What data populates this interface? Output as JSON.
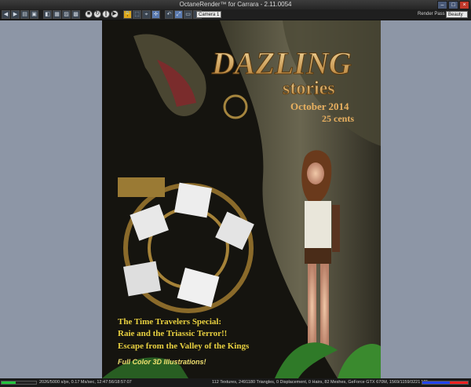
{
  "window": {
    "title": "OctaneRender™ for Carrara - 2.11.0054"
  },
  "toolbar": {
    "icons": [
      "back-icon",
      "forward-icon",
      "open-icon",
      "save-icon",
      "render-icon",
      "scene-icon",
      "image-icon",
      "settings-icon",
      "stop-icon",
      "restart-icon",
      "pause-icon",
      "start-icon",
      "lock-icon",
      "region-icon",
      "focus-icon",
      "pick-icon",
      "undo-icon",
      "fit-icon",
      "display-icon",
      "info-icon"
    ],
    "camera_value": "Camera 1",
    "render_pass_label": "Render Pass",
    "render_pass_value": "Beauty"
  },
  "cover": {
    "title_line1": "DAZLING",
    "title_line2": "stories",
    "date": "October 2014",
    "price": "25 cents",
    "headline1": "The Time Travelers Special:",
    "headline2": "Raie and the Triassic Terror!!",
    "headline3": "Escape from the Valley of the Kings",
    "tagline": "Full Color 3D Illustrations!"
  },
  "status": {
    "progress": 0.4,
    "left_text": "2026/5000 s/px, 0.17 Ms/sec, 12:47:56/18:57:07",
    "right_text": "112 Textures, 2491180 Triangles, 0 Displacement, 0 Hairs, 82 Meshes, GeForce GTX 670M, 1569/1159/3221 MB",
    "memory_colors": [
      "#2244ee",
      "#2244ee",
      "#2244ee",
      "#ee2222",
      "#ee2222"
    ]
  }
}
